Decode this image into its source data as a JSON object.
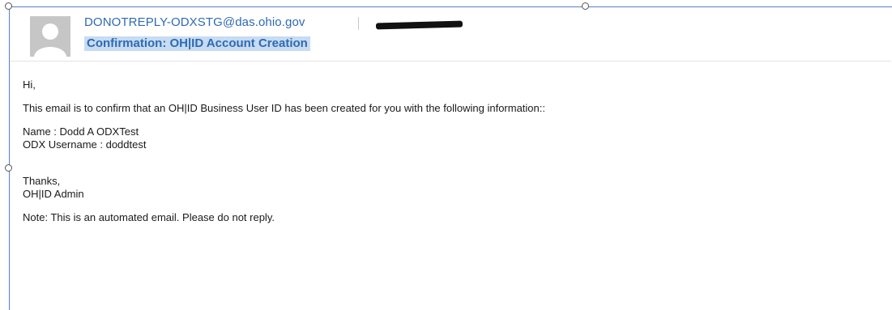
{
  "email": {
    "sender": "DONOTREPLY-ODXSTG@das.ohio.gov",
    "subject": "Confirmation: OH|ID Account Creation",
    "greeting": "Hi,",
    "intro": "This email is to confirm that an OH|ID Business User ID has been created for you with the following information::",
    "name_line": "Name : Dodd A ODXTest",
    "username_line": "ODX Username : doddtest",
    "closing": "Thanks,",
    "signature": "OH|ID Admin",
    "note": "Note: This is an automated email. Please do not reply."
  },
  "icons": {
    "avatar": "default-person-icon",
    "redaction": "redaction-mark"
  },
  "colors": {
    "link_blue": "#2e6ab4",
    "subject_highlight": "#c7dcf2",
    "avatar_bg": "#c6c6c6"
  }
}
